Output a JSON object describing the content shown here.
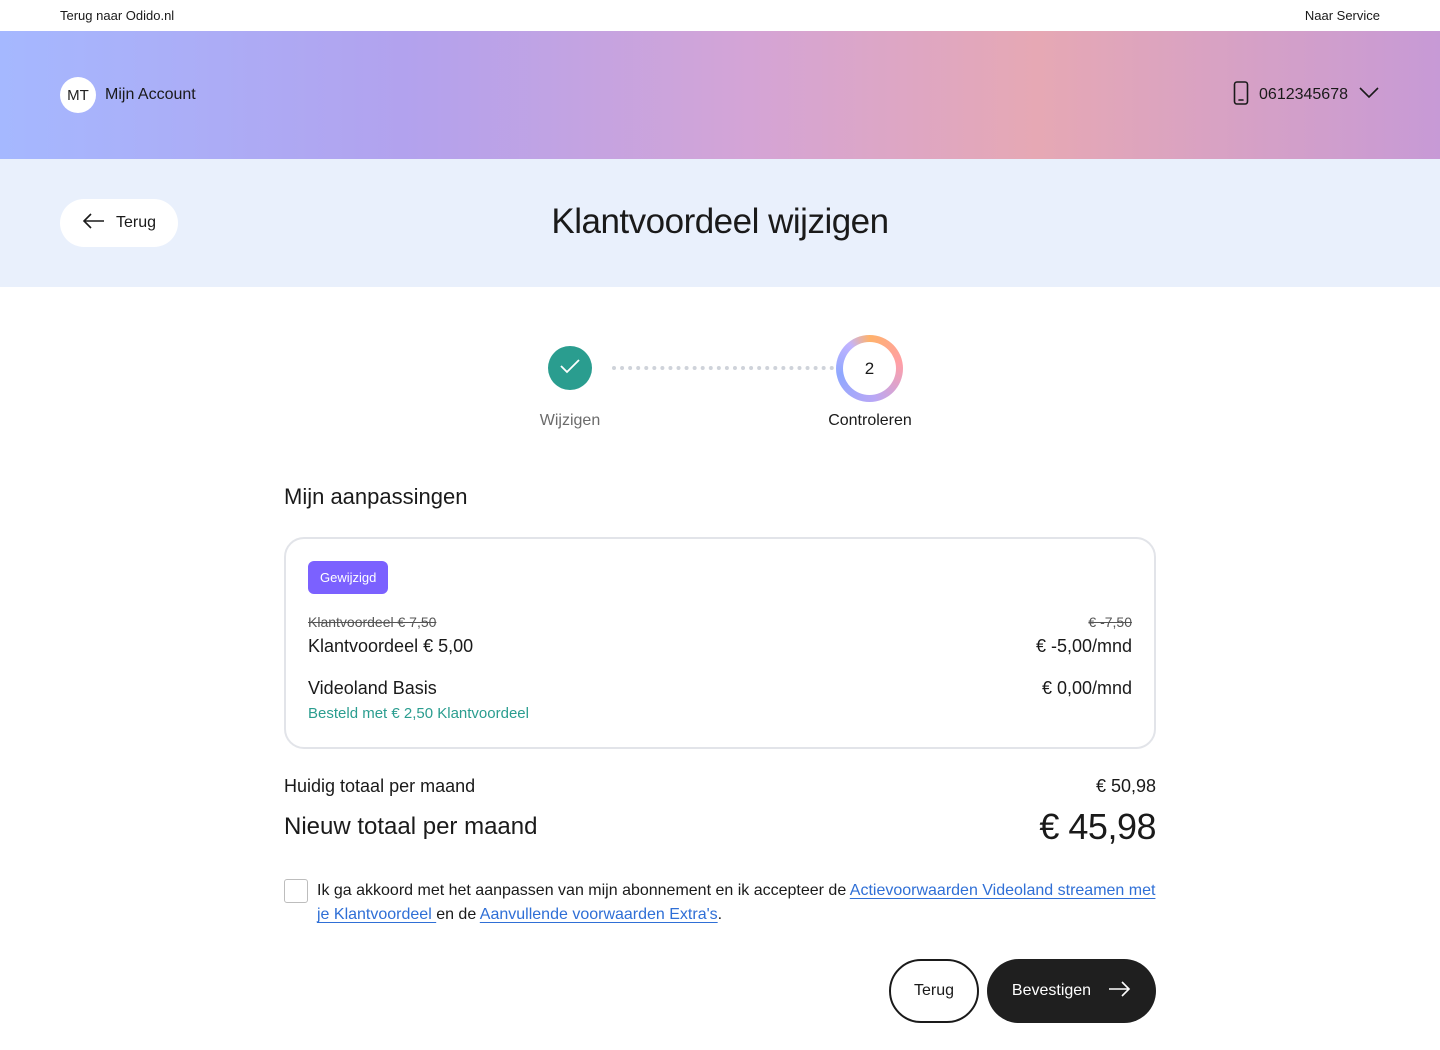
{
  "topbar": {
    "back_link": "Terug naar Odido.nl",
    "service_link": "Naar Service"
  },
  "header": {
    "avatar_initials": "MT",
    "account_label": "Mijn Account",
    "phone_number": "0612345678",
    "phone_icon": "mobile-phone-icon",
    "dropdown_icon": "chevron-down-icon"
  },
  "title_bar": {
    "back_button": "Terug",
    "page_title": "Klantvoordeel wijzigen"
  },
  "stepper": {
    "steps": [
      {
        "label": "Wijzigen",
        "state": "completed"
      },
      {
        "label": "Controleren",
        "number": "2",
        "state": "active"
      }
    ]
  },
  "changes": {
    "section_title": "Mijn aanpassingen",
    "badge": "Gewijzigd",
    "items": [
      {
        "old_label": "Klantvoordeel € 7,50",
        "old_price": "€ -7,50",
        "label": "Klantvoordeel € 5,00",
        "price": "€ -5,00/mnd"
      },
      {
        "label": "Videoland Basis",
        "price": "€ 0,00/mnd",
        "note": "Besteld met € 2,50 Klantvoordeel"
      }
    ]
  },
  "totals": {
    "current_label": "Huidig totaal per maand",
    "current_value": "€ 50,98",
    "new_label": "Nieuw totaal per maand",
    "new_value": "€ 45,98"
  },
  "agreement": {
    "checked": false,
    "text_before": "Ik ga akkoord met het aanpassen van mijn abonnement en ik accepteer de ",
    "link1": "Actievoorwaarden Videoland streamen met je Klantvoordeel ",
    "text_middle": "en de ",
    "link2": "Aanvullende voorwaarden Extra's",
    "text_after": "."
  },
  "actions": {
    "back_button": "Terug",
    "confirm_button": "Bevestigen"
  },
  "colors": {
    "accent_green": "#2a9d8f",
    "badge_purple": "#7b61ff",
    "link_blue": "#2f6fd6",
    "title_bar_bg": "#e9f0fc",
    "primary_button": "#1f1f1f"
  }
}
